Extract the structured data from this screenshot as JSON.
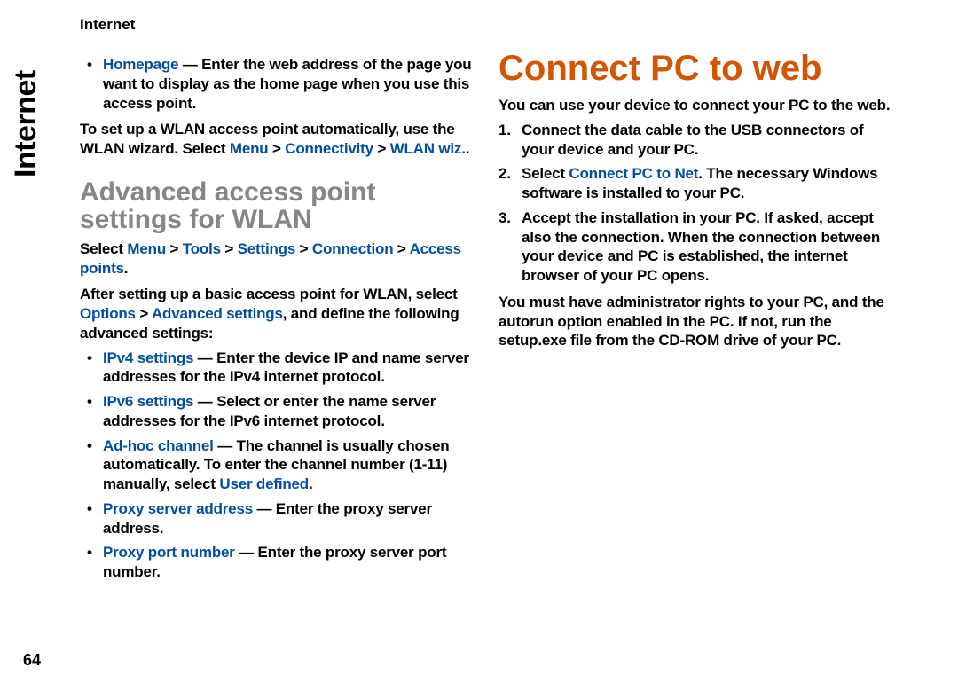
{
  "pageNumber": "64",
  "sideLabel": "Internet",
  "runningHeader": "Internet",
  "col1": {
    "bullet_homepage_kw": "Homepage",
    "bullet_homepage_txt": " — Enter the web address of the page you want to display as the home page when you use this access point.",
    "wlan_wiz_lead": "To set up a WLAN access point automatically, use the WLAN wizard. Select ",
    "wlan_wiz_path_menu": "Menu",
    "wlan_wiz_path_conn": "Connectivity",
    "wlan_wiz_path_wlan": "WLAN wiz.",
    "h2": "Advanced access point settings for WLAN",
    "path_lead": "Select ",
    "path_menu": "Menu",
    "path_tools": "Tools",
    "path_settings": "Settings",
    "path_connection": "Connection",
    "path_ap": "Access points",
    "intro_a": "After setting up a basic access point for WLAN, select ",
    "intro_opt": "Options",
    "intro_adv": "Advanced settings",
    "intro_b": ", and define the following advanced settings:",
    "b_ipv4_kw": "IPv4 settings",
    "b_ipv4_txt": " — Enter the device IP and name server addresses for the IPv4 internet protocol.",
    "b_ipv6_kw": "IPv6 settings",
    "b_ipv6_txt": " — Select or enter the name server addresses for the IPv6 internet protocol.",
    "b_adhoc_kw": "Ad-hoc channel",
    "b_adhoc_txt_a": " — The channel is usually chosen automatically. To enter the channel number (1-11) manually, select ",
    "b_adhoc_usr": "User defined",
    "b_adhoc_txt_b": ".",
    "b_proxyaddr_kw": "Proxy server address",
    "b_proxyaddr_txt": " — Enter the proxy server address.",
    "b_proxyport_kw": "Proxy port number",
    "b_proxyport_txt": " — Enter the proxy server port number."
  },
  "col2": {
    "h1": "Connect PC to web",
    "intro": "You can use your device to connect your PC to the web.",
    "step1": "Connect the data cable to the USB connectors of your device and your PC.",
    "step2_a": "Select ",
    "step2_kw": "Connect PC to Net",
    "step2_b": ". The necessary Windows software is installed to your PC.",
    "step3": "Accept the installation in your PC. If asked, accept also the connection. When the connection between your device and PC is established, the internet browser of your PC opens.",
    "outro": "You must have administrator rights to your PC, and the autorun option enabled in the PC. If not, run the setup.exe file from the CD-ROM drive of your PC."
  }
}
